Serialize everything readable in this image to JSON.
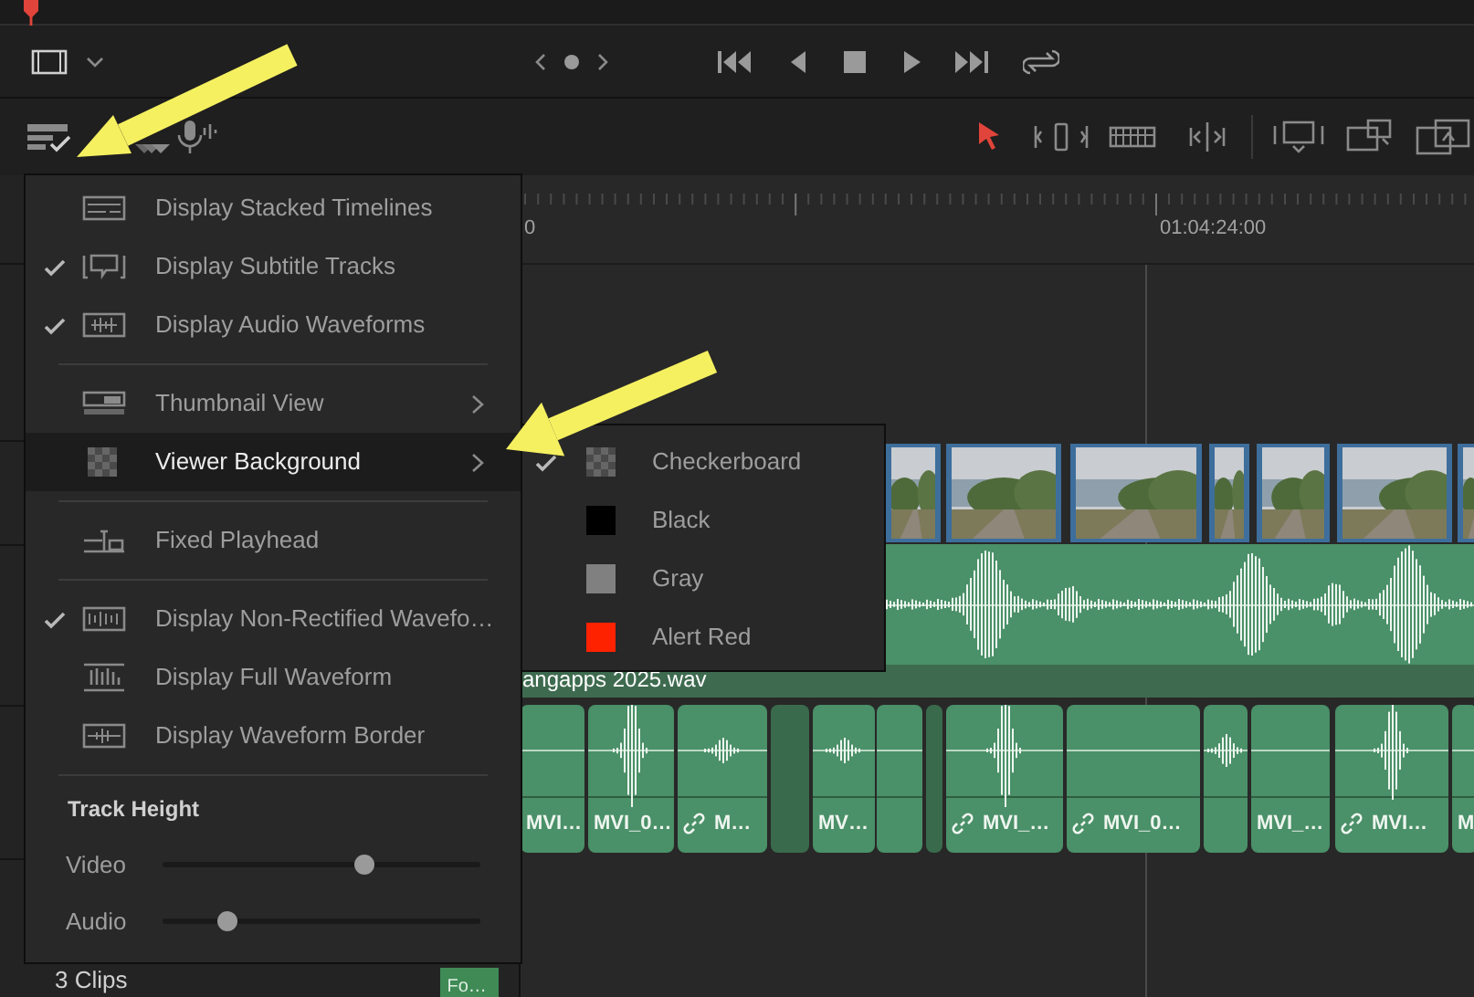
{
  "edit_tools": [
    {
      "selected": true
    },
    {
      "selected": false
    },
    {
      "selected": false
    },
    {
      "selected": false
    }
  ],
  "ruler": {
    "labels": [
      "0",
      "01:04:24:00"
    ]
  },
  "audio_track_1": {
    "clip_name": "angapps 2025.wav"
  },
  "audio_track_2": {
    "clips": [
      {
        "kind": "clip",
        "label": "MVI…",
        "linked": false
      },
      {
        "kind": "clip",
        "label": "MVI_0…",
        "linked": false
      },
      {
        "kind": "clip",
        "label": "M…",
        "linked": true
      },
      {
        "kind": "gap"
      },
      {
        "kind": "clip",
        "label": "MV…",
        "linked": false
      },
      {
        "kind": "clip",
        "linked": false
      },
      {
        "kind": "gap"
      },
      {
        "kind": "clip",
        "label": "MVI_…",
        "linked": true
      },
      {
        "kind": "clip",
        "label": "MVI_0…",
        "linked": true
      },
      {
        "kind": "clip",
        "linked": false
      },
      {
        "kind": "clip",
        "label": "MVI_…",
        "linked": false
      },
      {
        "kind": "clip",
        "label": "MVI…",
        "linked": true
      },
      {
        "kind": "clip",
        "label": "M",
        "linked": false
      }
    ]
  },
  "footer": {
    "clip_count": "3 Clips",
    "clip_label": "Fo…"
  },
  "view_menu": {
    "groups": [
      {
        "items": [
          {
            "label": "Display Stacked Timelines",
            "checked": false,
            "submenu": false,
            "selected": false
          },
          {
            "label": "Display Subtitle Tracks",
            "checked": true,
            "submenu": false,
            "selected": false
          },
          {
            "label": "Display Audio Waveforms",
            "checked": true,
            "submenu": false,
            "selected": false
          }
        ]
      },
      {
        "items": [
          {
            "label": "Thumbnail View",
            "checked": false,
            "submenu": true,
            "selected": false
          },
          {
            "label": "Viewer Background",
            "checked": false,
            "submenu": true,
            "selected": true
          }
        ]
      },
      {
        "items": [
          {
            "label": "Fixed Playhead",
            "checked": false,
            "submenu": false,
            "selected": false
          }
        ]
      },
      {
        "items": [
          {
            "label": "Display Non-Rectified Wavefo…",
            "checked": true,
            "submenu": false,
            "selected": false
          },
          {
            "label": "Display Full Waveform",
            "checked": false,
            "submenu": false,
            "selected": false
          },
          {
            "label": "Display Waveform Border",
            "checked": false,
            "submenu": false,
            "selected": false
          }
        ]
      }
    ],
    "track_height": {
      "title": "Track Height",
      "sliders": [
        {
          "label": "Video",
          "level": 0.63
        },
        {
          "label": "Audio",
          "level": 0.2
        }
      ]
    }
  },
  "viewer_background_menu": {
    "items": [
      {
        "label": "Checkerboard",
        "checked": true,
        "kind": "checkerboard"
      },
      {
        "label": "Black",
        "checked": false,
        "kind": "swatch",
        "color": "#000000"
      },
      {
        "label": "Gray",
        "checked": false,
        "kind": "swatch",
        "color": "#808080"
      },
      {
        "label": "Alert Red",
        "checked": false,
        "kind": "swatch",
        "color": "#ff2200"
      }
    ]
  }
}
